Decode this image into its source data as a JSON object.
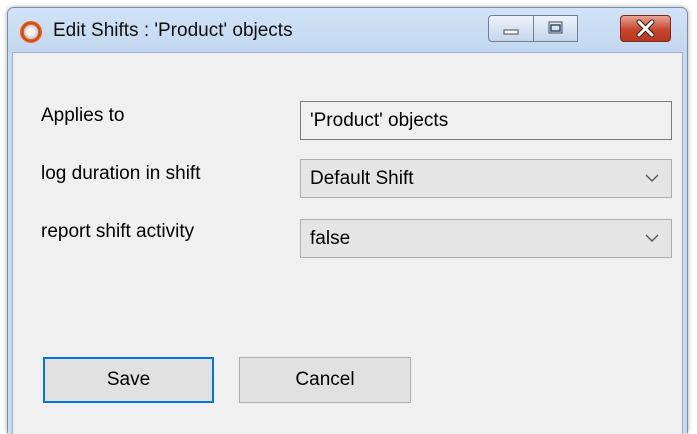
{
  "window": {
    "title": "Edit Shifts : 'Product' objects",
    "icon": "orange-ring-icon",
    "controls": [
      "minimize-icon",
      "maximize-icon",
      "close-icon"
    ],
    "close_color": "#c7462d"
  },
  "form": {
    "applies_to": {
      "label": "Applies to",
      "value": "'Product' objects"
    },
    "log_duration": {
      "label": "log duration in shift",
      "value": "Default Shift"
    },
    "report_activity": {
      "label": "report shift activity",
      "value": "false"
    }
  },
  "buttons": {
    "save": "Save",
    "cancel": "Cancel"
  },
  "colors": {
    "focus_border": "#0078d7",
    "titlebar": "#c6daf0",
    "client": "#f0f0f0"
  }
}
